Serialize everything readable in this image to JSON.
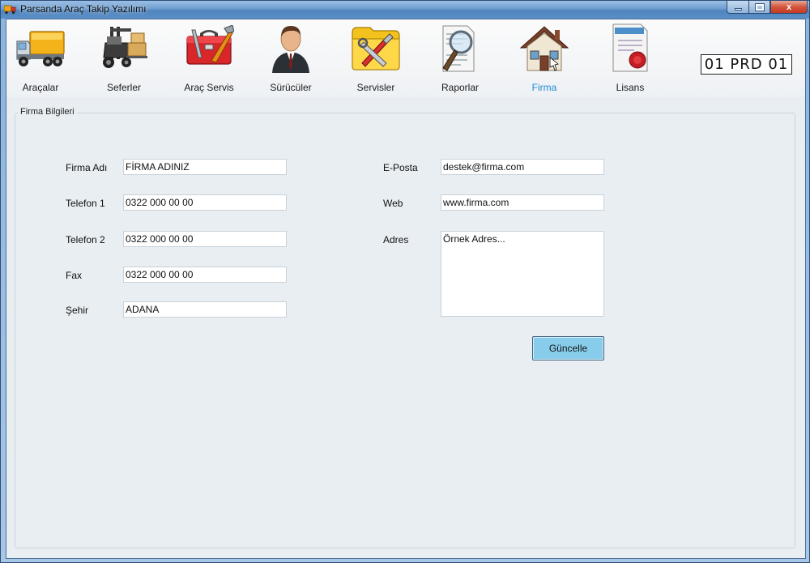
{
  "window": {
    "title": "Parsanda Araç Takip Yazılımı",
    "close_glyph": "x"
  },
  "toolbar": {
    "items": [
      {
        "label": "Araçalar",
        "icon": "truck-icon"
      },
      {
        "label": "Seferler",
        "icon": "forklift-icon"
      },
      {
        "label": "Araç Servis",
        "icon": "toolbox-icon"
      },
      {
        "label": "Sürücüler",
        "icon": "person-icon"
      },
      {
        "label": "Servisler",
        "icon": "tools-icon"
      },
      {
        "label": "Raporlar",
        "icon": "magnifier-report-icon"
      },
      {
        "label": "Firma",
        "icon": "house-icon",
        "active": true
      },
      {
        "label": "Lisans",
        "icon": "certificate-icon"
      }
    ],
    "code": "01 PRD 01"
  },
  "group": {
    "title": "Firma Bilgileri"
  },
  "form": {
    "firma_adi": {
      "label": "Firma Adı",
      "value": "FİRMA ADINIZ"
    },
    "telefon1": {
      "label": "Telefon 1",
      "value": "0322 000 00 00"
    },
    "telefon2": {
      "label": "Telefon 2",
      "value": "0322 000 00 00"
    },
    "fax": {
      "label": "Fax",
      "value": "0322 000 00 00"
    },
    "sehir": {
      "label": "Şehir",
      "value": "ADANA"
    },
    "eposta": {
      "label": "E-Posta",
      "value": "destek@firma.com"
    },
    "web": {
      "label": "Web",
      "value": "www.firma.com"
    },
    "adres": {
      "label": "Adres",
      "value": "Örnek Adres..."
    },
    "update_button": "Güncelle"
  },
  "colors": {
    "accent": "#1e8ad6",
    "button": "#87cdeb"
  }
}
